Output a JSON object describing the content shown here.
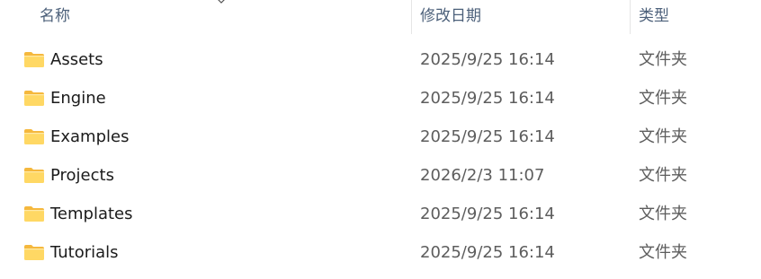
{
  "header": {
    "name_label": "名称",
    "date_label": "修改日期",
    "type_label": "类型"
  },
  "colors": {
    "folder_front": "#FFD864",
    "folder_back": "#F5B83D",
    "header_text": "#4C607A"
  },
  "icons": {
    "folder": "folder-icon",
    "sort": "sort-caret-icon"
  },
  "rows": [
    {
      "name": "Assets",
      "date": "2025/9/25 16:14",
      "type": "文件夹"
    },
    {
      "name": "Engine",
      "date": "2025/9/25 16:14",
      "type": "文件夹"
    },
    {
      "name": "Examples",
      "date": "2025/9/25 16:14",
      "type": "文件夹"
    },
    {
      "name": "Projects",
      "date": "2026/2/3 11:07",
      "type": "文件夹"
    },
    {
      "name": "Templates",
      "date": "2025/9/25 16:14",
      "type": "文件夹"
    },
    {
      "name": "Tutorials",
      "date": "2025/9/25 16:14",
      "type": "文件夹"
    }
  ]
}
